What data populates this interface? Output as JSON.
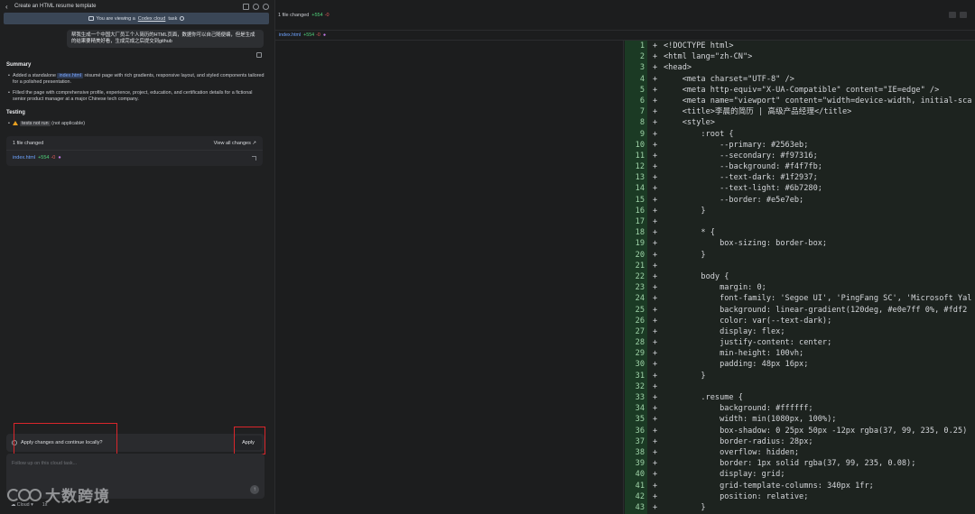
{
  "left": {
    "title": "Create an HTML resume template",
    "cloud_banner": {
      "prefix": "You are viewing a",
      "link": "Codex cloud",
      "suffix": "task"
    },
    "user_message": "帮我生成一个中国大厂员工个人简历的HTML页面，数据你可以自己随便编，但是生成的结果要精美好看，生成完成之后提交到github",
    "summary_title": "Summary",
    "summary_b1_pre": "Added a standalone",
    "summary_b1_file": "index.html",
    "summary_b1_post": "résumé page with rich gradients, responsive layout, and styled components tailored for a polished presentation.",
    "summary_b2": "Filled the page with comprehensive profile, experience, project, education, and certification details for a fictional senior product manager at a major Chinese tech company.",
    "testing_title": "Testing",
    "testing_chip": "tests not run",
    "testing_note": "(not applicable)",
    "files_changed": "1 file changed",
    "view_all": "View all changes",
    "file_name": "index.html",
    "file_plus": "+554",
    "file_minus": "-0",
    "apply_prompt": "Apply changes and continue locally?",
    "apply_button": "Apply",
    "composer_placeholder": "Follow up on this cloud task...",
    "bottom_cloud": "Cloud",
    "bottom_count": "1x",
    "watermark_text": "大数跨境"
  },
  "right": {
    "files_changed": "1 file changed",
    "plus": "+554",
    "minus": "-0",
    "tab_file": "index.html",
    "tab_plus": "+554",
    "tab_minus": "-0"
  },
  "code_lines": [
    {
      "n": "1",
      "t": "<!DOCTYPE html>"
    },
    {
      "n": "2",
      "t": "<html lang=\"zh-CN\">"
    },
    {
      "n": "3",
      "t": "<head>"
    },
    {
      "n": "4",
      "t": "    <meta charset=\"UTF-8\" />"
    },
    {
      "n": "5",
      "t": "    <meta http-equiv=\"X-UA-Compatible\" content=\"IE=edge\" />"
    },
    {
      "n": "6",
      "t": "    <meta name=\"viewport\" content=\"width=device-width, initial-sca"
    },
    {
      "n": "7",
      "t": "    <title>李晨的简历 | 高级产品经理</title>"
    },
    {
      "n": "8",
      "t": "    <style>"
    },
    {
      "n": "9",
      "t": "        :root {"
    },
    {
      "n": "10",
      "t": "            --primary: #2563eb;"
    },
    {
      "n": "11",
      "t": "            --secondary: #f97316;"
    },
    {
      "n": "12",
      "t": "            --background: #f4f7fb;"
    },
    {
      "n": "13",
      "t": "            --text-dark: #1f2937;"
    },
    {
      "n": "14",
      "t": "            --text-light: #6b7280;"
    },
    {
      "n": "15",
      "t": "            --border: #e5e7eb;"
    },
    {
      "n": "16",
      "t": "        }"
    },
    {
      "n": "17",
      "t": ""
    },
    {
      "n": "18",
      "t": "        * {"
    },
    {
      "n": "19",
      "t": "            box-sizing: border-box;"
    },
    {
      "n": "20",
      "t": "        }"
    },
    {
      "n": "21",
      "t": ""
    },
    {
      "n": "22",
      "t": "        body {"
    },
    {
      "n": "23",
      "t": "            margin: 0;"
    },
    {
      "n": "24",
      "t": "            font-family: 'Segoe UI', 'PingFang SC', 'Microsoft Yal"
    },
    {
      "n": "25",
      "t": "            background: linear-gradient(120deg, #e0e7ff 0%, #fdf2"
    },
    {
      "n": "26",
      "t": "            color: var(--text-dark);"
    },
    {
      "n": "27",
      "t": "            display: flex;"
    },
    {
      "n": "28",
      "t": "            justify-content: center;"
    },
    {
      "n": "29",
      "t": "            min-height: 100vh;"
    },
    {
      "n": "30",
      "t": "            padding: 48px 16px;"
    },
    {
      "n": "31",
      "t": "        }"
    },
    {
      "n": "32",
      "t": ""
    },
    {
      "n": "33",
      "t": "        .resume {"
    },
    {
      "n": "34",
      "t": "            background: #ffffff;"
    },
    {
      "n": "35",
      "t": "            width: min(1080px, 100%);"
    },
    {
      "n": "36",
      "t": "            box-shadow: 0 25px 50px -12px rgba(37, 99, 235, 0.25)"
    },
    {
      "n": "37",
      "t": "            border-radius: 28px;"
    },
    {
      "n": "38",
      "t": "            overflow: hidden;"
    },
    {
      "n": "39",
      "t": "            border: 1px solid rgba(37, 99, 235, 0.08);"
    },
    {
      "n": "40",
      "t": "            display: grid;"
    },
    {
      "n": "41",
      "t": "            grid-template-columns: 340px 1fr;"
    },
    {
      "n": "42",
      "t": "            position: relative;"
    },
    {
      "n": "43",
      "t": "        }"
    }
  ]
}
